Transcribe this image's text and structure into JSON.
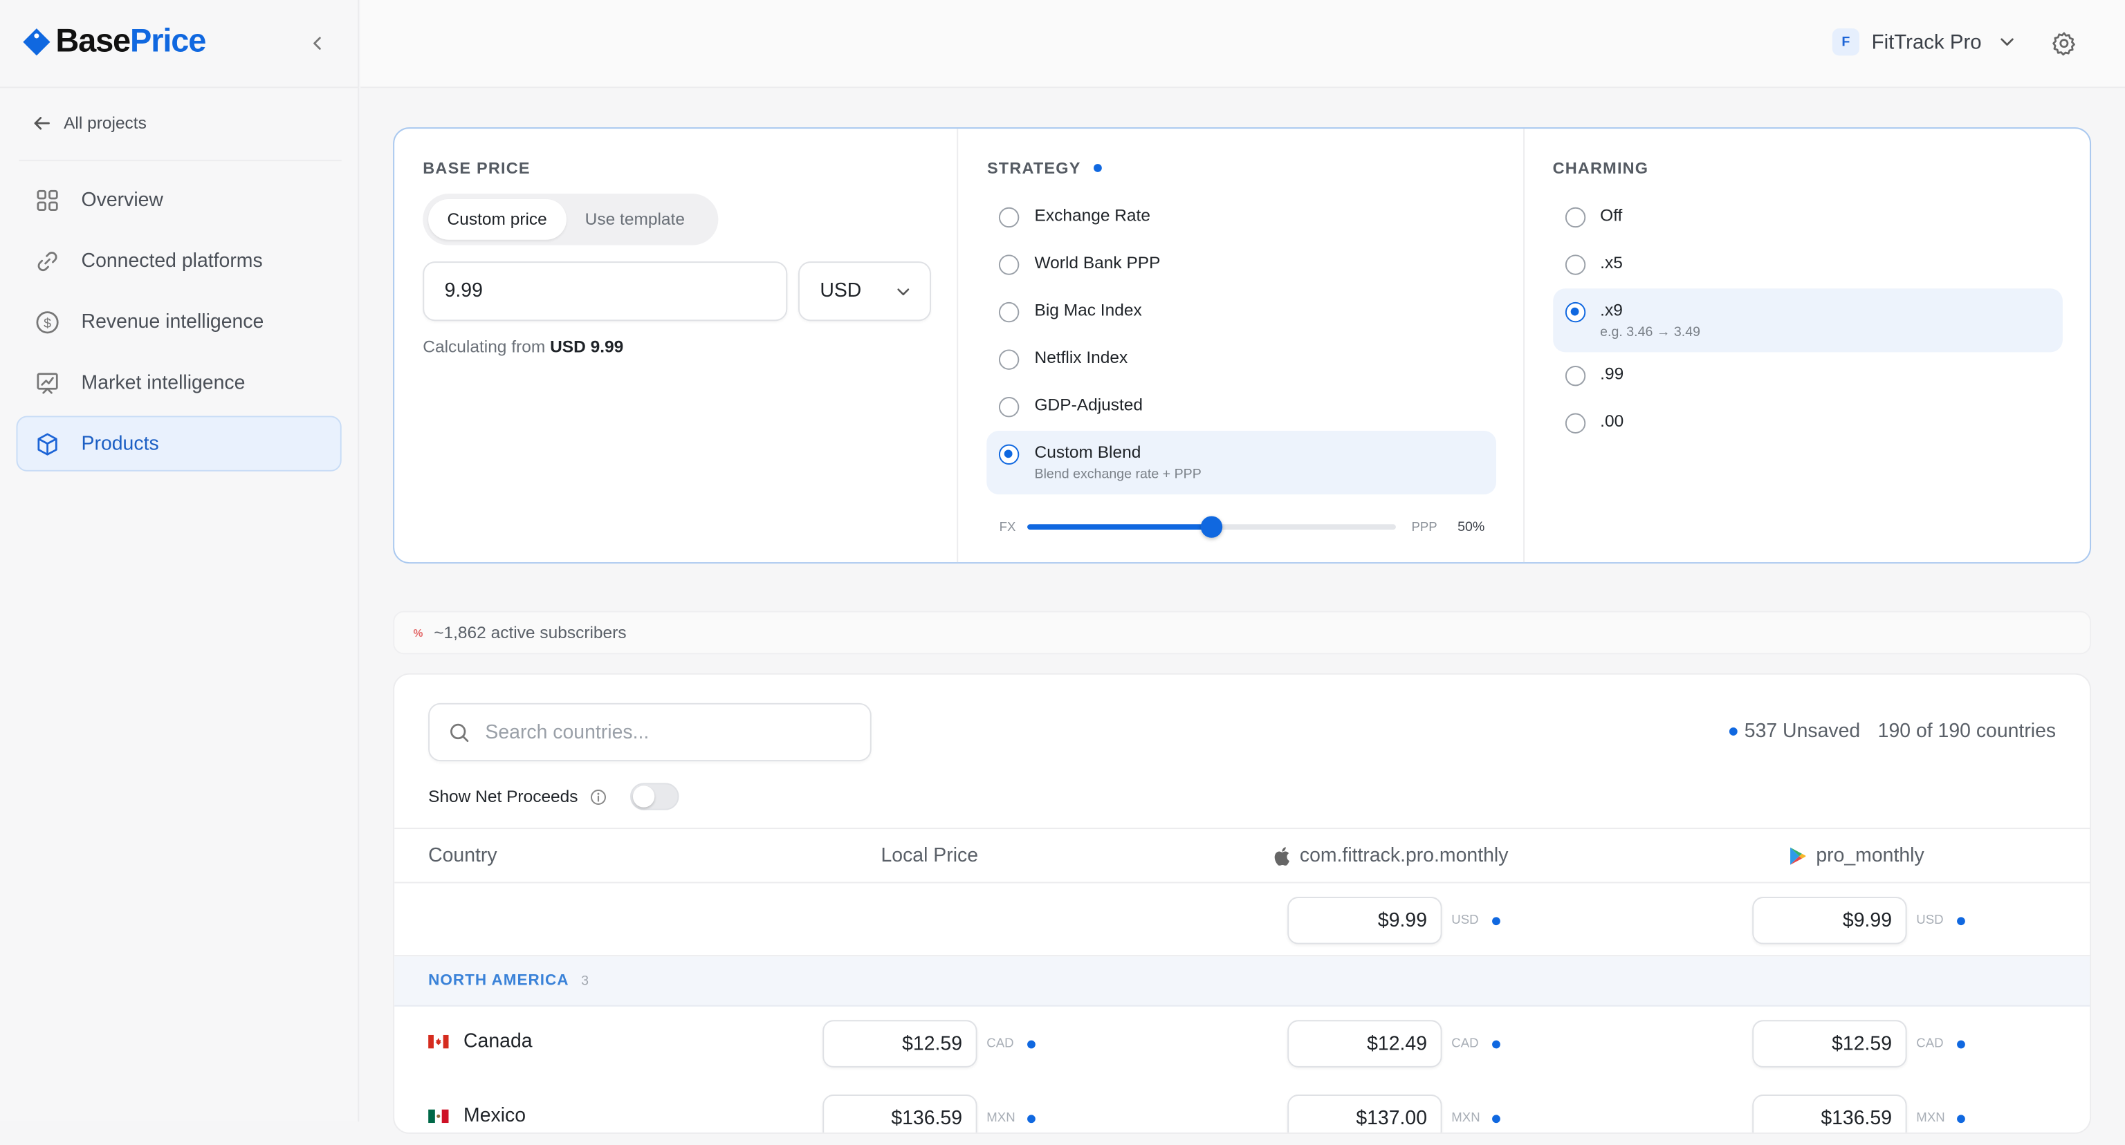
{
  "app": {
    "logo_part1": "Base",
    "logo_part2": "Price"
  },
  "sidebar": {
    "back_label": "All projects",
    "items": [
      {
        "label": "Overview",
        "icon": "grid-icon"
      },
      {
        "label": "Connected platforms",
        "icon": "link-icon"
      },
      {
        "label": "Revenue intelligence",
        "icon": "dollar-circle-icon"
      },
      {
        "label": "Market intelligence",
        "icon": "chart-board-icon"
      },
      {
        "label": "Products",
        "icon": "cube-icon",
        "active": true
      }
    ]
  },
  "header": {
    "project_initial": "F",
    "project_name": "FitTrack Pro"
  },
  "base_price": {
    "title": "BASE PRICE",
    "tab_custom": "Custom price",
    "tab_template": "Use template",
    "value": "9.99",
    "currency": "USD",
    "note_prefix": "Calculating from",
    "note_value": "USD 9.99"
  },
  "strategy": {
    "title": "STRATEGY",
    "options": [
      {
        "label": "Exchange Rate"
      },
      {
        "label": "World Bank PPP"
      },
      {
        "label": "Big Mac Index"
      },
      {
        "label": "Netflix Index"
      },
      {
        "label": "GDP-Adjusted"
      },
      {
        "label": "Custom Blend",
        "sub": "Blend exchange rate + PPP",
        "selected": true
      }
    ],
    "blend_left": "FX",
    "blend_right": "PPP",
    "blend_value": 0.5,
    "blend_label": "50%"
  },
  "charming": {
    "title": "CHARMING",
    "options": [
      {
        "label": "Off"
      },
      {
        "label": ".x5"
      },
      {
        "label": ".x9",
        "sub": "e.g. 3.46 → 3.49",
        "selected": true
      },
      {
        "label": ".99"
      },
      {
        "label": ".00"
      }
    ]
  },
  "subscribers": {
    "badge": "%",
    "text": "~1,862 active subscribers"
  },
  "table": {
    "search_placeholder": "Search countries...",
    "unsaved": "537 Unsaved",
    "count": "190 of 190 countries",
    "net_proceeds_label": "Show Net Proceeds",
    "col_country": "Country",
    "col_local": "Local Price",
    "col_apple": "com.fittrack.pro.monthly",
    "col_google": "pro_monthly",
    "base_apple": "$9.99",
    "base_google": "$9.99",
    "base_currency": "USD",
    "region_name": "NORTH AMERICA",
    "region_count": "3",
    "rows": [
      {
        "country": "Canada",
        "local": "$12.59",
        "apple": "$12.49",
        "google": "$12.59",
        "currency": "CAD"
      },
      {
        "country": "Mexico",
        "local": "$136.59",
        "apple": "$137.00",
        "google": "$136.59",
        "currency": "MXN"
      }
    ]
  },
  "colors": {
    "accent": "#1068e0",
    "active_bg": "#e9f1fd"
  }
}
